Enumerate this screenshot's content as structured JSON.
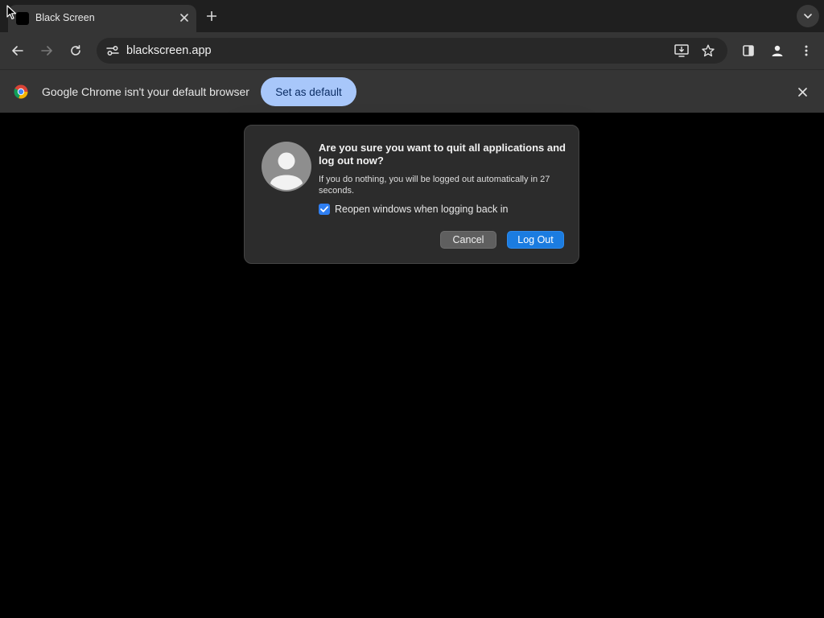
{
  "tab": {
    "title": "Black Screen",
    "close_icon": "close-icon",
    "new_tab_icon": "plus-icon"
  },
  "toolbar": {
    "url": "blackscreen.app",
    "icons": [
      "back-arrow-icon",
      "forward-arrow-icon",
      "reload-icon",
      "site-settings-icon",
      "install-app-icon",
      "bookmark-star-icon",
      "side-panel-icon",
      "profile-icon",
      "more-menu-icon"
    ]
  },
  "infobar": {
    "message": "Google Chrome isn't your default browser",
    "set_default_label": "Set as default"
  },
  "dialog": {
    "title": "Are you sure you want to quit all applications and log out now?",
    "body": "If you do nothing, you will be logged out automatically in 27 seconds.",
    "checkbox_label": "Reopen windows when logging back in",
    "checkbox_checked": true,
    "cancel_label": "Cancel",
    "logout_label": "Log Out"
  },
  "colors": {
    "page_background": "#000000",
    "chrome_frame": "#353535",
    "infobar_button": "#a8c7fa",
    "primary_button": "#1b7ce0",
    "checkbox": "#2f7ff2"
  }
}
